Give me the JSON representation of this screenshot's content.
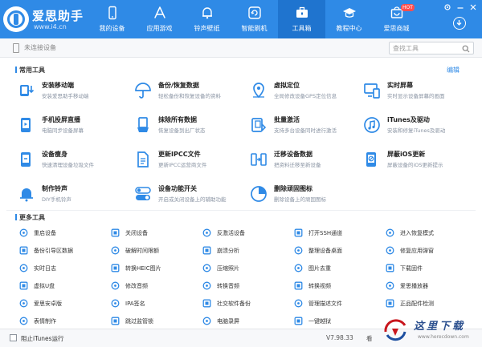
{
  "app": {
    "name": "爱思助手",
    "url": "www.i4.cn"
  },
  "nav": [
    {
      "label": "我的设备",
      "icon": "phone-icon"
    },
    {
      "label": "应用游戏",
      "icon": "appstore-icon"
    },
    {
      "label": "铃声壁纸",
      "icon": "bell-icon"
    },
    {
      "label": "智能刷机",
      "icon": "refresh-box-icon"
    },
    {
      "label": "工具箱",
      "icon": "toolbox-icon",
      "active": true
    },
    {
      "label": "教程中心",
      "icon": "graduation-cap-icon"
    },
    {
      "label": "爱思商城",
      "icon": "store-icon",
      "badge": "HOT"
    }
  ],
  "device_bar": {
    "status": "未连接设备",
    "search_placeholder": "查找工具"
  },
  "common_tools": {
    "title": "常用工具",
    "edit_label": "编辑",
    "items": [
      {
        "name": "安装移动端",
        "desc": "安装爱思助手移动端",
        "icon": "install-mobile-icon",
        "color": "#2f8ae6"
      },
      {
        "name": "备份/恢复数据",
        "desc": "轻松备份和恢复设备的资料",
        "icon": "umbrella-icon",
        "color": "#2f8ae6"
      },
      {
        "name": "虚拟定位",
        "desc": "全局修改设备GPS定位信息",
        "icon": "location-pin-icon",
        "color": "#2f8ae6"
      },
      {
        "name": "实时屏幕",
        "desc": "实时显示设备屏幕的画面",
        "icon": "live-screen-icon",
        "color": "#2f8ae6"
      },
      {
        "name": "手机投屏直播",
        "desc": "电脑同步设备屏幕",
        "icon": "screen-cast-icon",
        "color": "#2f8ae6"
      },
      {
        "name": "抹除所有数据",
        "desc": "恢复设备到出厂状态",
        "icon": "eraser-icon",
        "color": "#2f8ae6"
      },
      {
        "name": "批量激活",
        "desc": "支持多台设备同时进行激活",
        "icon": "batch-activate-icon",
        "color": "#2f8ae6"
      },
      {
        "name": "iTunes及驱动",
        "desc": "安装和修复iTunes及驱动",
        "icon": "itunes-icon",
        "color": "#2f8ae6"
      },
      {
        "name": "设备瘦身",
        "desc": "快速清理设备垃圾文件",
        "icon": "slim-device-icon",
        "color": "#2f8ae6"
      },
      {
        "name": "更新IPCC文件",
        "desc": "更新IPCC运营商文件",
        "icon": "ipcc-file-icon",
        "color": "#2f8ae6"
      },
      {
        "name": "迁移设备数据",
        "desc": "把资料迁移至新设备",
        "icon": "migrate-data-icon",
        "color": "#2f8ae6"
      },
      {
        "name": "屏蔽iOS更新",
        "desc": "屏蔽设备的iOS更新提示",
        "icon": "block-update-icon",
        "color": "#2f8ae6"
      },
      {
        "name": "制作铃声",
        "desc": "DIY手机铃声",
        "icon": "make-ringtone-icon",
        "color": "#2f8ae6"
      },
      {
        "name": "设备功能开关",
        "desc": "开启或关闭设备上的辅助功能",
        "icon": "toggle-switch-icon",
        "color": "#2f8ae6"
      },
      {
        "name": "删除顽固图标",
        "desc": "删除设备上的顽固图标",
        "icon": "pie-chart-icon",
        "color": "#2f8ae6"
      }
    ]
  },
  "more_tools": {
    "title": "更多工具",
    "items": [
      {
        "label": "重启设备",
        "icon": "restart-icon"
      },
      {
        "label": "关闭设备",
        "icon": "power-icon"
      },
      {
        "label": "反激活设备",
        "icon": "deactivate-icon"
      },
      {
        "label": "打开SSH通道",
        "icon": "ssh-icon"
      },
      {
        "label": "进入恢复模式",
        "icon": "recovery-mode-icon"
      },
      {
        "label": "备份引导区数据",
        "icon": "boot-backup-icon"
      },
      {
        "label": "破解时间限额",
        "icon": "time-limit-icon"
      },
      {
        "label": "崩溃分析",
        "icon": "crash-analysis-icon"
      },
      {
        "label": "整理设备桌面",
        "icon": "desktop-organize-icon"
      },
      {
        "label": "修复应用弹窗",
        "icon": "fix-popup-icon"
      },
      {
        "label": "实时日志",
        "icon": "log-icon"
      },
      {
        "label": "转换HEIC图片",
        "icon": "heic-convert-icon"
      },
      {
        "label": "压缩照片",
        "icon": "compress-photo-icon"
      },
      {
        "label": "图片去重",
        "icon": "dedupe-image-icon"
      },
      {
        "label": "下载固件",
        "icon": "download-firmware-icon"
      },
      {
        "label": "虚拟U盘",
        "icon": "virtual-usb-icon"
      },
      {
        "label": "修改音频",
        "icon": "edit-audio-icon"
      },
      {
        "label": "转换音频",
        "icon": "convert-audio-icon"
      },
      {
        "label": "转换视频",
        "icon": "convert-video-icon"
      },
      {
        "label": "爱思播放器",
        "icon": "player-icon"
      },
      {
        "label": "爱思安卓版",
        "icon": "android-icon"
      },
      {
        "label": "IPA签名",
        "icon": "ipa-sign-icon"
      },
      {
        "label": "社交软件备份",
        "icon": "social-backup-icon"
      },
      {
        "label": "管理描述文件",
        "icon": "profile-manage-icon"
      },
      {
        "label": "正品配件检测",
        "icon": "accessory-check-icon"
      },
      {
        "label": "表情制作",
        "icon": "emoji-make-icon"
      },
      {
        "label": "跳过监管锁",
        "icon": "skip-supervision-icon"
      },
      {
        "label": "电脑录屏",
        "icon": "screen-record-icon"
      },
      {
        "label": "一键越狱",
        "icon": "jailbreak-icon"
      }
    ]
  },
  "footer": {
    "itunes_label": "阻止iTunes运行",
    "version": "V7.98.33",
    "cut_text": "看",
    "watermark_text": "这里下载",
    "watermark_url": "www.herecdown.com"
  },
  "colors": {
    "header_bg": "#2f8ae6",
    "accent": "#2f8ae6",
    "active_tab": "#1f74cf"
  }
}
